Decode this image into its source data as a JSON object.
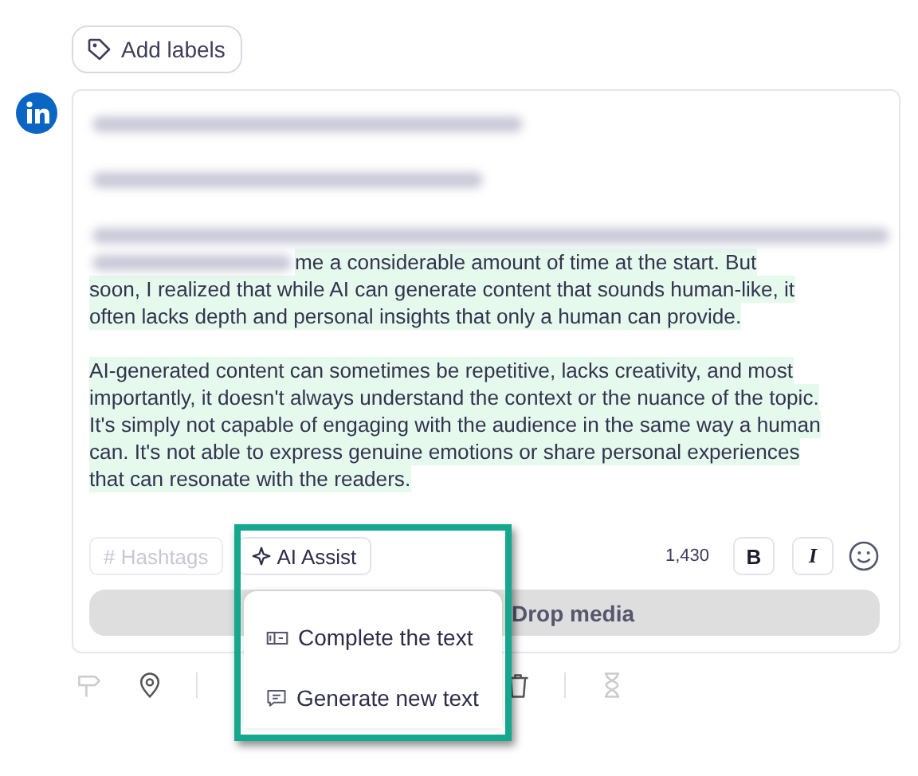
{
  "labels_button": {
    "label": "Add labels"
  },
  "post": {
    "first_tail": "me a considerable amount of time at the start. But",
    "first_lines": [
      "soon, I realized that while AI can generate content that sounds human-like, it",
      "often lacks depth and personal insights that only a human can provide."
    ],
    "paragraph": [
      "AI-generated content can sometimes be repetitive, lacks creativity, and most",
      "importantly, it doesn't always understand the context or the nuance of the topic.",
      "It's simply not capable of engaging with the audience in the same way a human",
      "can. It's not able to express genuine emotions or share personal experiences",
      "that can resonate with the readers."
    ]
  },
  "toolbar": {
    "hashtags": {
      "label": "# Hashtags",
      "disabled": true
    },
    "ai_assist": {
      "label": "AI Assist"
    },
    "count": "1,430",
    "bold": "B",
    "italic": "I"
  },
  "drop_media": "Drop media",
  "menu": [
    {
      "kind": "complete",
      "label": "Complete the text"
    },
    {
      "kind": "generate",
      "label": "Generate new text"
    }
  ],
  "bottom_tools": [
    {
      "kind": "signpost",
      "disabled": true
    },
    {
      "kind": "pin",
      "disabled": false
    },
    {
      "kind": "divider"
    },
    {
      "kind": "trash",
      "disabled": false
    },
    {
      "kind": "divider"
    },
    {
      "kind": "hourglass",
      "disabled": true
    }
  ]
}
